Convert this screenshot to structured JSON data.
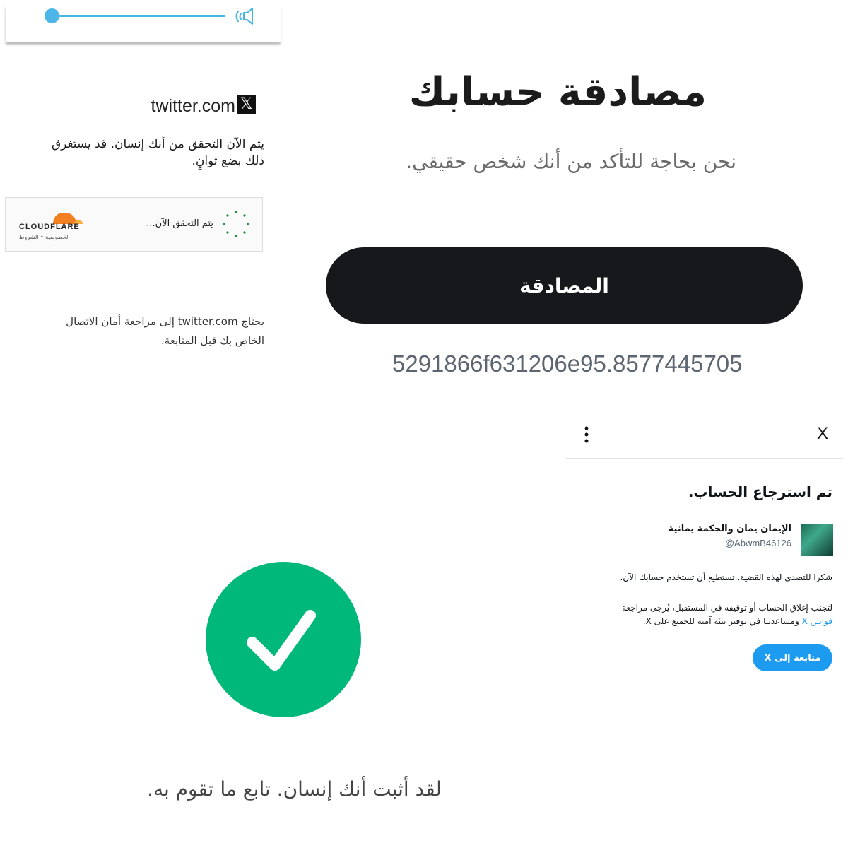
{
  "cloudflare": {
    "site": "twitter.com",
    "x_logo": "𝕏",
    "verifying_text": "يتم الآن التحقق من أنك إنسان. قد يستغرق ذلك بضع ثوانٍ.",
    "widget_status": "يتم التحقق الآن...",
    "brand": "CLOUDFLARE",
    "privacy_link": "الخصوصية",
    "separator": " • ",
    "terms_link": "الشروط",
    "security_text": "يحتاج twitter.com إلى مراجعة أمان الاتصال الخاص بك قبل المتابعة.",
    "brand_color": "#f38020"
  },
  "audio": {
    "slider_value": 0,
    "accent": "#45b5e6",
    "icon": "speaker-icon"
  },
  "auth": {
    "title": "مصادقة حسابك",
    "subtitle": "نحن بحاجة للتأكد من أنك شخص حقيقي.",
    "button_label": "المصادقة",
    "code": "5291866f631206e95.8577445705"
  },
  "success": {
    "message": "لقد أثبت أنك إنسان. تابع ما تقوم به.",
    "icon": "check-circle-icon",
    "color": "#00b87a"
  },
  "restored": {
    "close_label": "X",
    "title": "تم استرجاع الحساب.",
    "account_name": "الإيمان يمان والحكمة يمانية",
    "account_handle": "@AbwmB46126",
    "thanks_text": "شكرا للتصدي لهذه القضية. تستطيع أن تستخدم حسابك الآن.",
    "rules_before": "لتجنب إغلاق الحساب أو توقيفه في المستقبل، يُرجى مراجعة",
    "rules_link": "قوانين X",
    "rules_after": "ومساعدتنا في توفير بيئة آمنة للجميع على X.",
    "continue_label": "متابعة إلى X",
    "accent": "#1d9bf0"
  }
}
